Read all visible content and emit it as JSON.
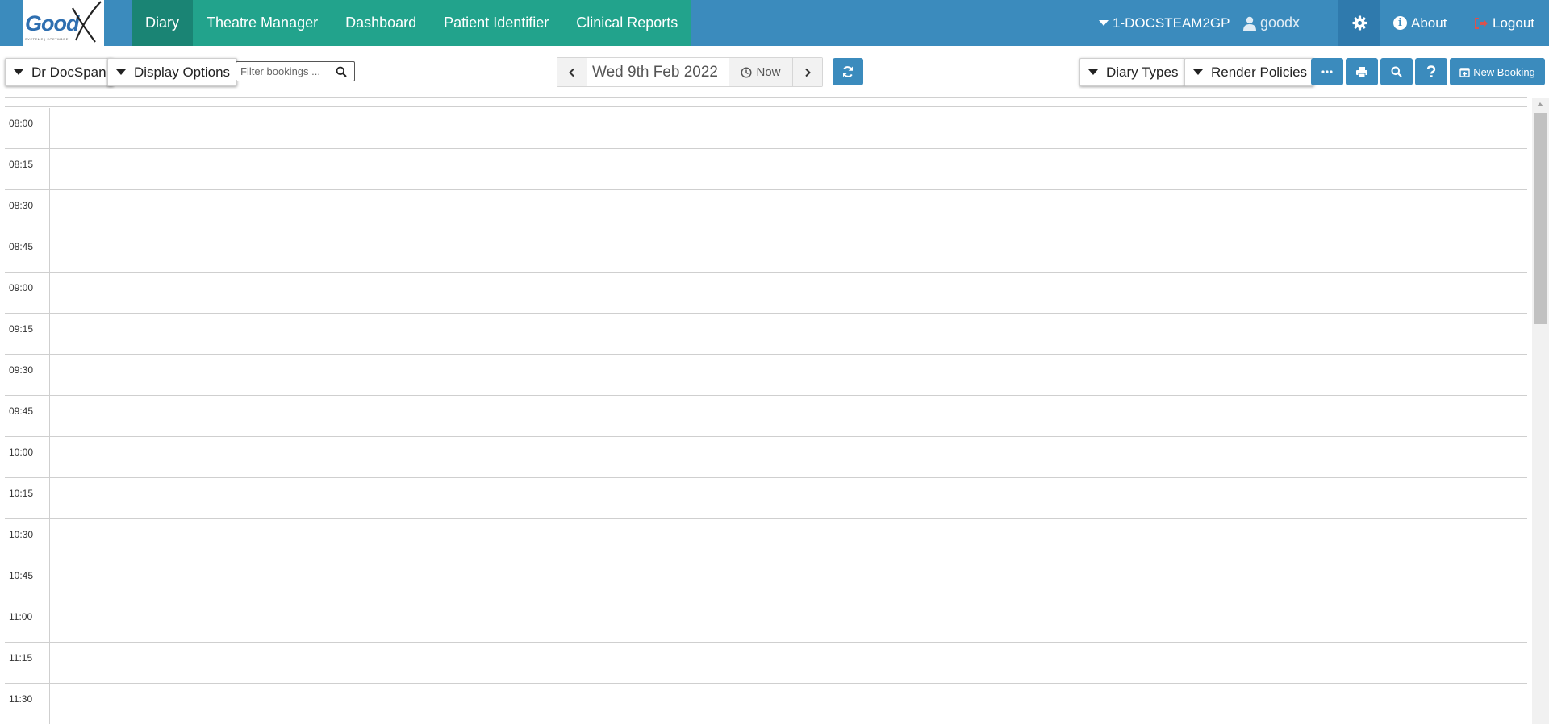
{
  "nav": {
    "logo_text": "Good",
    "logo_sub": "SYSTEMS | SOFTWARE",
    "tabs": [
      {
        "label": "Diary",
        "active": true
      },
      {
        "label": "Theatre Manager",
        "active": false
      },
      {
        "label": "Dashboard",
        "active": false
      },
      {
        "label": "Patient Identifier",
        "active": false
      },
      {
        "label": "Clinical Reports",
        "active": false
      }
    ],
    "practice": "1-DOCSTEAM2GP",
    "user": "goodx",
    "about": "About",
    "logout": "Logout"
  },
  "toolbar": {
    "doctor": "Dr DocSpan",
    "display_options": "Display Options",
    "filter_placeholder": "Filter bookings ...",
    "date": "Wed 9th Feb 2022",
    "now": "Now",
    "diary_types": "Diary Types",
    "render_policies": "Render Policies",
    "new_booking": "New Booking"
  },
  "diary": {
    "times": [
      "08:00",
      "08:15",
      "08:30",
      "08:45",
      "09:00",
      "09:15",
      "09:30",
      "09:45",
      "10:00",
      "10:15",
      "10:30",
      "10:45",
      "11:00",
      "11:15",
      "11:30"
    ]
  },
  "colors": {
    "navbar": "#3b8bbd",
    "tabs": "#22a38c",
    "active_tab": "#1a8474",
    "button": "#3b8bbd",
    "logout_icon": "#d9534f"
  }
}
